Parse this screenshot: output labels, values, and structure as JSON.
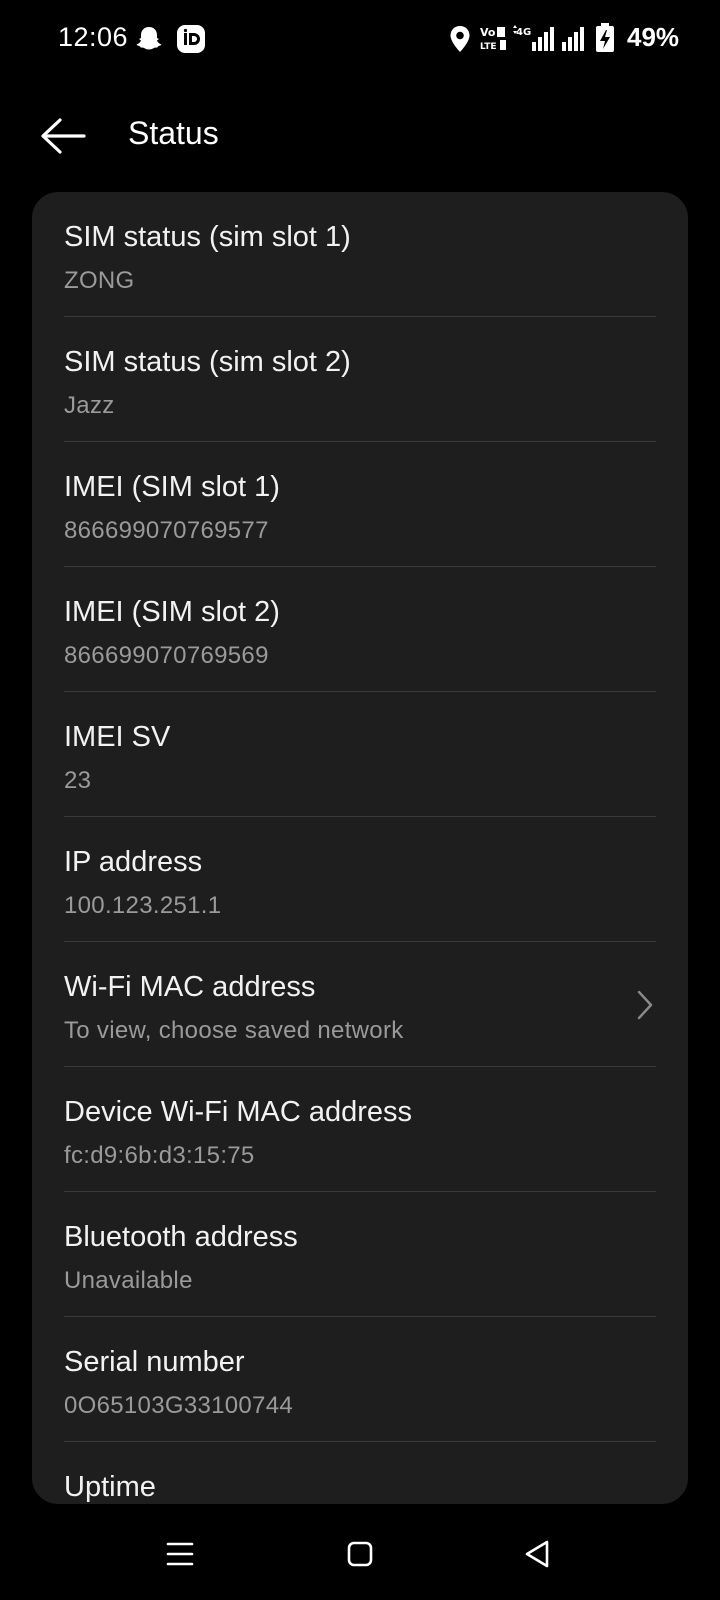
{
  "status_bar": {
    "time": "12:06",
    "battery": "49%",
    "network": "4G",
    "volte": "VoLTE"
  },
  "app_bar": {
    "title": "Status"
  },
  "items": [
    {
      "title": "SIM status (sim slot 1)",
      "subtitle": "ZONG"
    },
    {
      "title": "SIM status (sim slot 2)",
      "subtitle": "Jazz"
    },
    {
      "title": "IMEI (SIM slot 1)",
      "subtitle": "866699070769577"
    },
    {
      "title": "IMEI (SIM slot 2)",
      "subtitle": "866699070769569"
    },
    {
      "title": "IMEI SV",
      "subtitle": "23"
    },
    {
      "title": "IP address",
      "subtitle": "100.123.251.1"
    },
    {
      "title": "Wi-Fi MAC address",
      "subtitle": "To view, choose saved network"
    },
    {
      "title": "Device Wi-Fi MAC address",
      "subtitle": "fc:d9:6b:d3:15:75"
    },
    {
      "title": "Bluetooth address",
      "subtitle": "Unavailable"
    },
    {
      "title": "Serial number",
      "subtitle": "0O65103G33100744"
    },
    {
      "title": "Uptime",
      "subtitle": ""
    }
  ],
  "nav": {
    "icons": [
      "menu-icon",
      "home-square-icon",
      "back-triangle-icon"
    ]
  },
  "colors": {
    "background": "#000000",
    "card": "#1e1e1e",
    "divider": "#3a3a3a",
    "subtitle": "#9a9a9a"
  }
}
